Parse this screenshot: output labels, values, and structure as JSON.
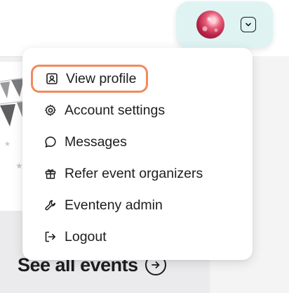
{
  "menu": {
    "items": [
      {
        "label": "View profile",
        "icon": "profile-icon",
        "active": true
      },
      {
        "label": "Account settings",
        "icon": "gear-icon"
      },
      {
        "label": "Messages",
        "icon": "chat-bubble-icon"
      },
      {
        "label": "Refer event organizers",
        "icon": "gift-icon"
      },
      {
        "label": "Eventeny admin",
        "icon": "wrench-icon"
      },
      {
        "label": "Logout",
        "icon": "logout-icon"
      }
    ]
  },
  "background": {
    "see_all_label": "See all events"
  },
  "colors": {
    "active_outline": "#f08a5d",
    "profile_chip_bg": "#dff3f3",
    "text": "#1d1d1f"
  }
}
